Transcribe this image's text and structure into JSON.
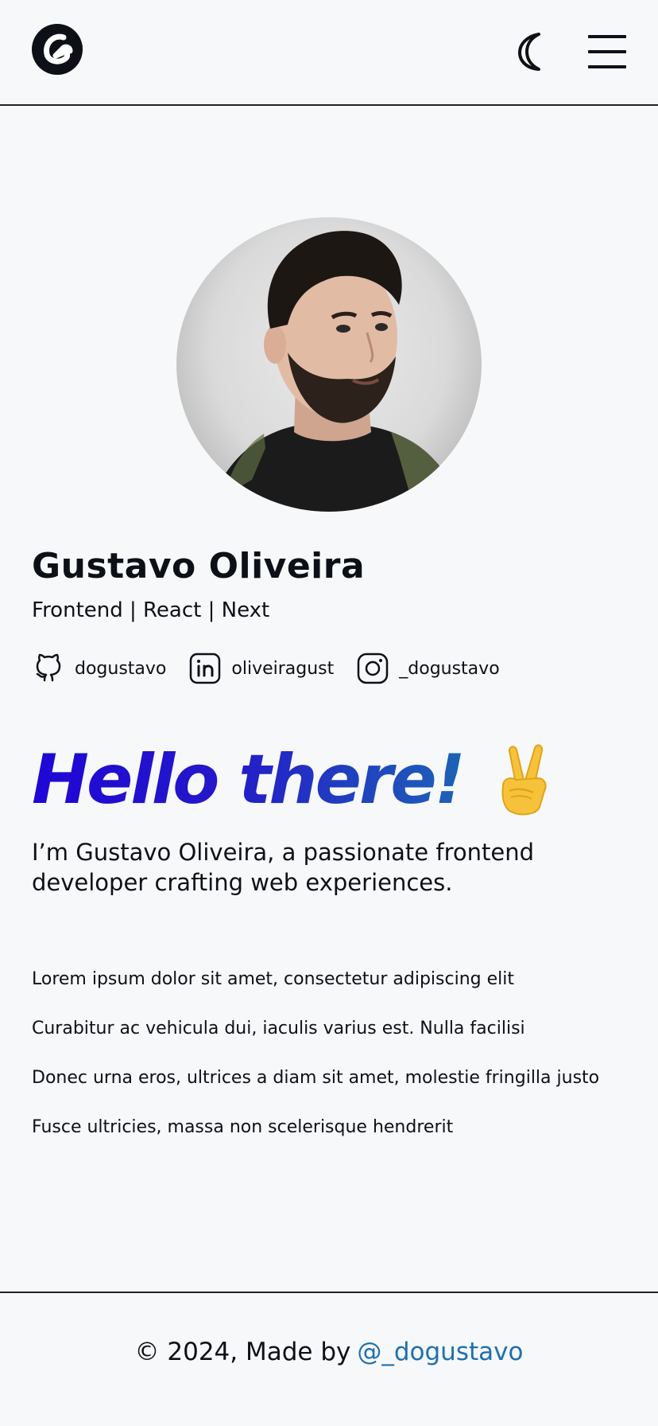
{
  "header": {
    "logo_icon": "g-logo-icon",
    "theme_icon": "moon-icon",
    "menu_icon": "hamburger-menu-icon"
  },
  "profile": {
    "name": "Gustavo Oliveira",
    "role": "Frontend | React | Next"
  },
  "socials": [
    {
      "icon": "github-icon",
      "label": "dogustavo"
    },
    {
      "icon": "linkedin-icon",
      "label": "oliveiragust"
    },
    {
      "icon": "instagram-icon",
      "label": "_dogustavo"
    }
  ],
  "hero": {
    "greeting": "Hello there!",
    "emoji_icon": "victory-hand-emoji",
    "intro": "I’m Gustavo Oliveira, a passionate frontend developer crafting web experiences."
  },
  "items": [
    "Lorem ipsum dolor sit amet, consectetur adipiscing elit",
    "Curabitur ac vehicula dui, iaculis varius est. Nulla facilisi",
    "Donec urna eros, ultrices a diam sit amet, molestie fringilla justo",
    "Fusce ultricies, massa non scelerisque hendrerit"
  ],
  "footer": {
    "prefix": "© 2024, Made by",
    "link_label": "@_dogustavo"
  },
  "colors": {
    "background": "#f6f8fa",
    "text": "#0d1117",
    "greeting_gradient_start": "#1f06d6",
    "greeting_gradient_end": "#1d63b6",
    "link": "#1f6fb0"
  }
}
